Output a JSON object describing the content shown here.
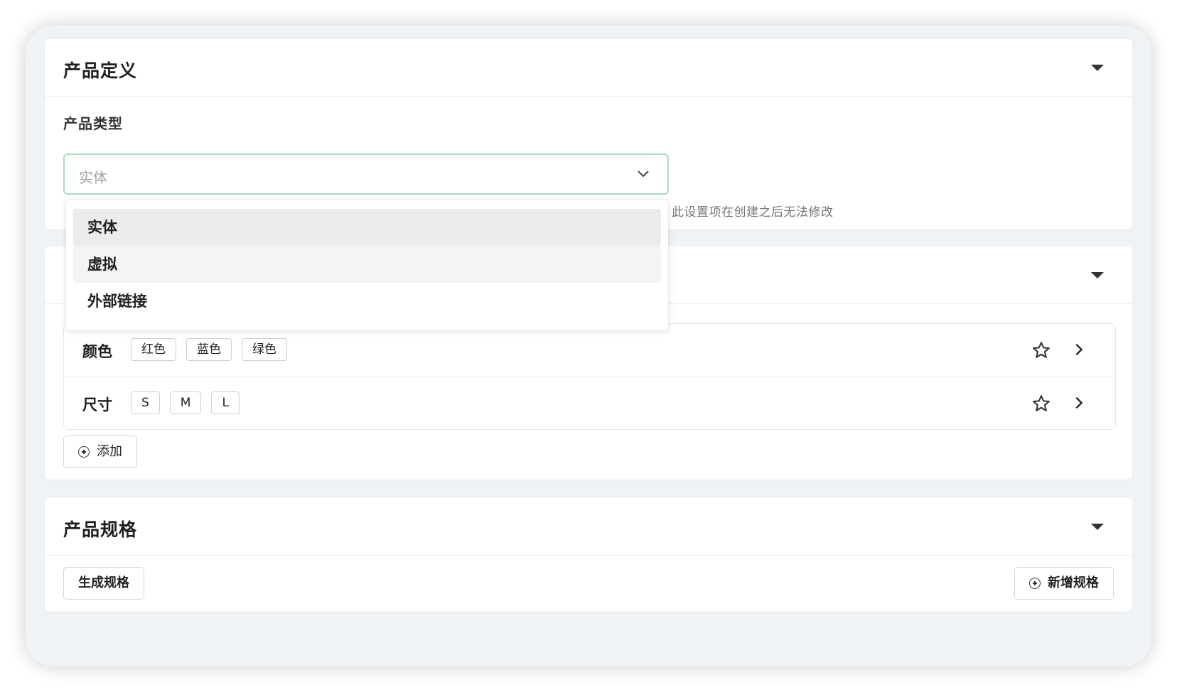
{
  "definition": {
    "title": "产品定义",
    "field_label": "产品类型",
    "selected_value": "实体",
    "helper_text": "此设置项在创建之后无法修改"
  },
  "dropdown": {
    "options": [
      "实体",
      "虚拟",
      "外部链接"
    ],
    "selected_index": 0,
    "hovered_index": 1
  },
  "attributes": {
    "rows": [
      {
        "name": "颜色",
        "tags": [
          "红色",
          "蓝色",
          "绿色"
        ]
      },
      {
        "name": "尺寸",
        "tags": [
          "S",
          "M",
          "L"
        ]
      }
    ],
    "add_label": "添加"
  },
  "specs": {
    "title": "产品规格",
    "generate_label": "生成规格",
    "add_label": "新增规格"
  },
  "icons": {
    "collapse": "caret-down-icon",
    "select": "chevron-down-icon",
    "favorite": "star-icon",
    "open": "chevron-right-icon",
    "add": "plus-circle-icon"
  }
}
